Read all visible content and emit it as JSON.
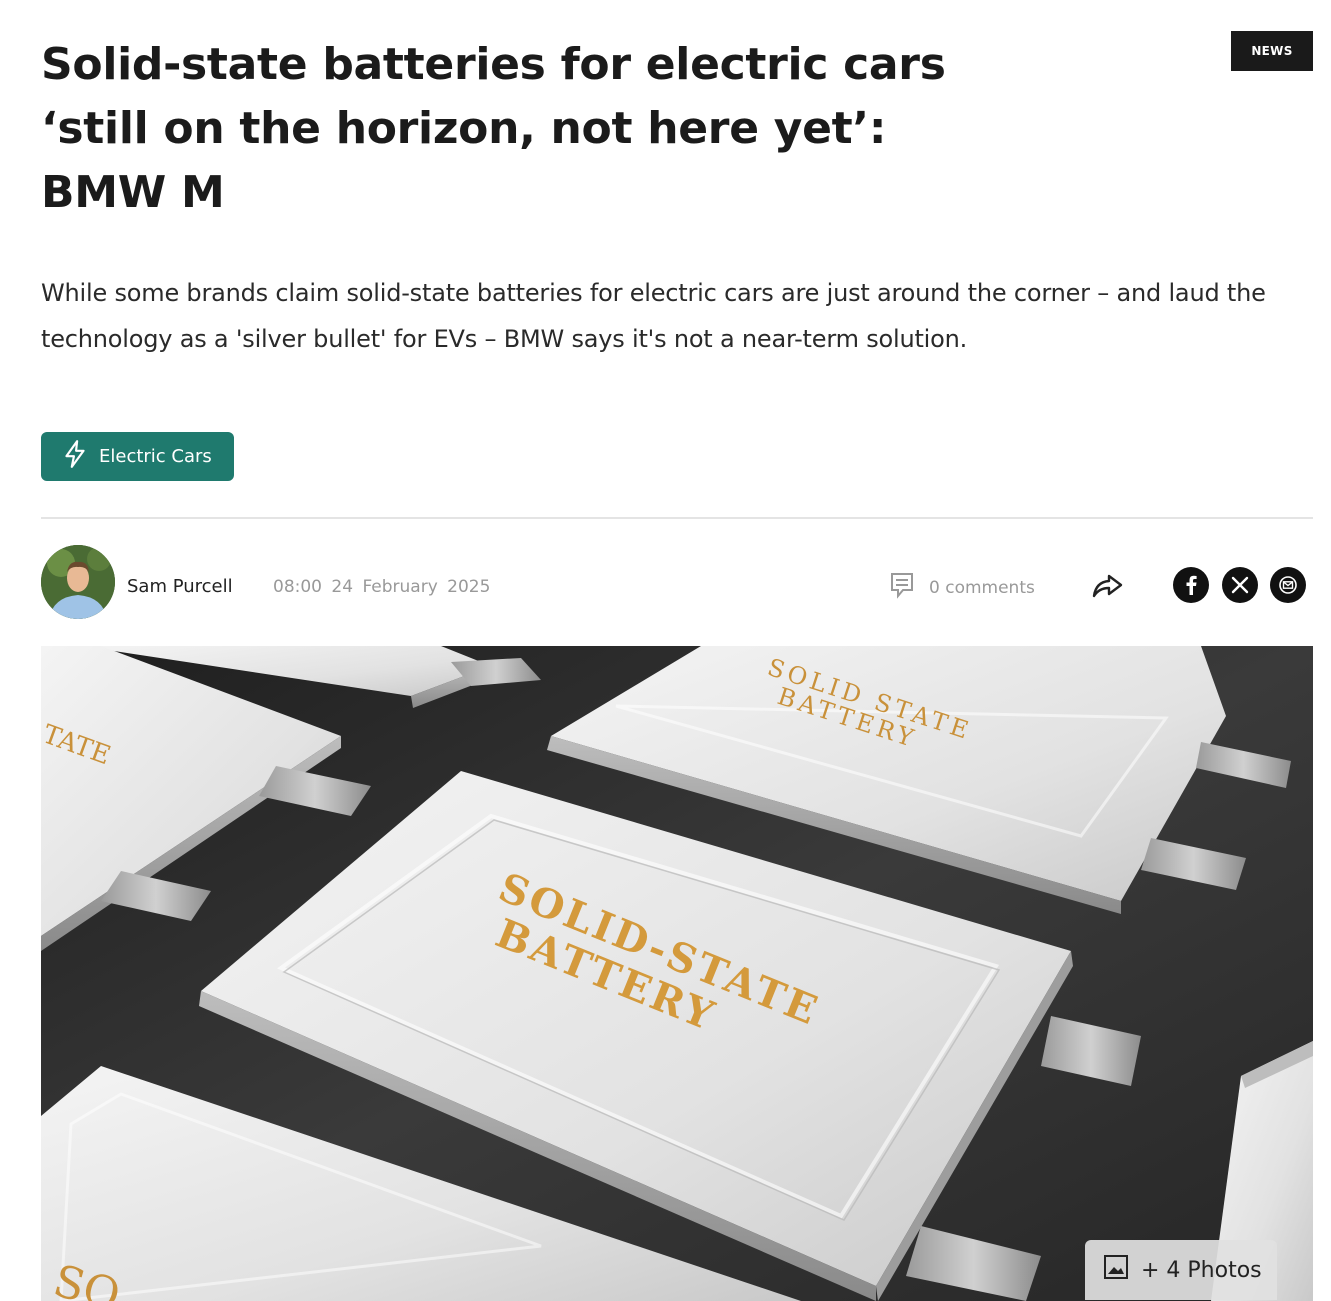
{
  "badge": {
    "label": "NEWS"
  },
  "article": {
    "title": "Solid-state batteries for electric cars ‘still on the horizon, not here yet’: BMW M",
    "standfirst": "While some brands claim solid-state batteries for electric cars are just around the corner – and laud the technology as a 'silver bullet' for EVs – BMW says it's not a near-term solution.",
    "tag": {
      "label": "Electric Cars",
      "icon": "lightning-icon",
      "color": "#1f7a6e"
    }
  },
  "byline": {
    "author": "Sam Purcell",
    "time": "08:00",
    "date": "24 February 2025",
    "comments_label": "0 comments",
    "share_icon": "share-arrow-icon",
    "social": [
      "facebook-icon",
      "x-icon",
      "mail-icon"
    ]
  },
  "hero": {
    "main_battery_text_line1": "SOLID-STATE",
    "main_battery_text_line2": "BATTERY",
    "back_battery_text_line1": "SOLID STATE",
    "back_battery_text_line2": "BATTERY",
    "left_battery_text": "TATE",
    "bottom_battery_text": "SO",
    "photos_label": "+ 4 Photos"
  }
}
